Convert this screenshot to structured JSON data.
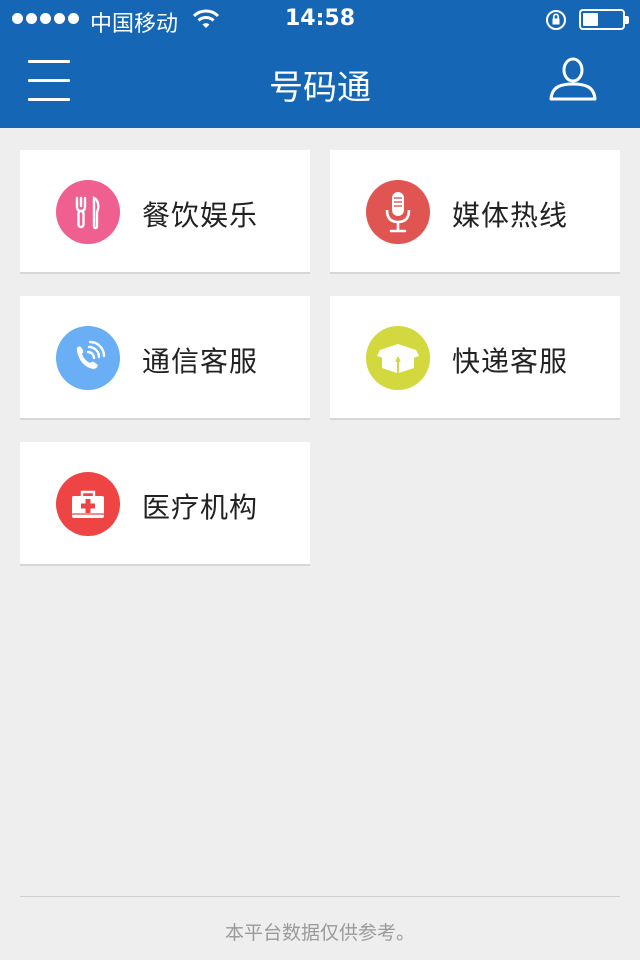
{
  "status_bar": {
    "carrier": "中国移动",
    "time": "14:58",
    "battery_level": 0.4
  },
  "header": {
    "title": "号码通",
    "menu_icon": "hamburger-menu-icon",
    "user_icon": "user-profile-icon"
  },
  "categories": [
    {
      "label": "餐饮娱乐",
      "icon": "fork-knife-icon",
      "color": "#ef5f8f"
    },
    {
      "label": "媒体热线",
      "icon": "microphone-icon",
      "color": "#e05452"
    },
    {
      "label": "通信客服",
      "icon": "phone-call-icon",
      "color": "#6aaef5"
    },
    {
      "label": "快递客服",
      "icon": "package-box-icon",
      "color": "#d3d83f"
    },
    {
      "label": "医疗机构",
      "icon": "first-aid-kit-icon",
      "color": "#ee4444"
    }
  ],
  "footer": {
    "disclaimer": "本平台数据仅供参考。"
  },
  "colors": {
    "header_bg": "#1567b6",
    "page_bg": "#eeeeee"
  }
}
